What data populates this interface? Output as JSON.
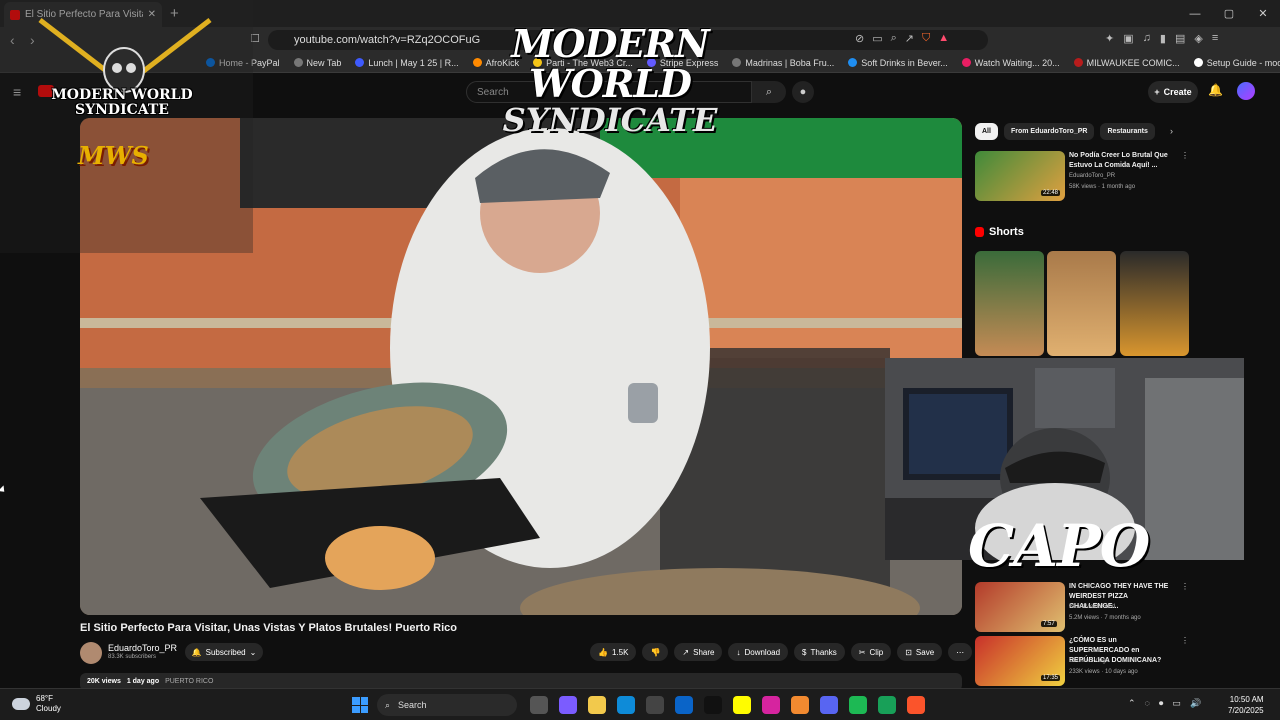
{
  "browser": {
    "tab_title": "El Sitio Perfecto Para Visitar, U",
    "new_tab": "+",
    "url": "youtube.com/watch?v=RZq2OCOFuG",
    "window_controls": [
      "—",
      "▢",
      "✕"
    ]
  },
  "bookmarks": [
    "Home - PayPal",
    "New Tab",
    "Lunch | May 1 25 | R...",
    "AfroKick",
    "Parti - The Web3 Cr...",
    "Stripe Express",
    "Madrinas | Boba Fru...",
    "Soft Drinks in Bever...",
    "Watch Waiting... 20...",
    "MILWAUKEE COMIC...",
    "Setup Guide - moon..."
  ],
  "youtube": {
    "search_placeholder": "Search",
    "create_label": "Create"
  },
  "video": {
    "title": "El Sitio Perfecto Para Visitar, Unas Vistas Y Platos Brutales! Puerto Rico",
    "channel": "EduardoToro_PR",
    "subscribers": "83.3K subscribers",
    "subscribed_label": "Subscribed",
    "likes": "1.5K",
    "share_label": "Share",
    "download_label": "Download",
    "thanks_label": "Thanks",
    "clip_label": "Clip",
    "save_label": "Save",
    "views": "20K views",
    "age": "1 day ago",
    "tag": "PUERTO RICO"
  },
  "sidebar": {
    "chips": [
      "All",
      "From EduardoToro_PR",
      "Restaurants"
    ],
    "shorts_heading": "Shorts",
    "recommendations": [
      {
        "title": "No Podía Creer Lo Brutal Que Estuvo La Comida Aquí! ...",
        "channel": "EduardoToro_PR",
        "meta": "58K views · 1 month ago",
        "duration": "22:48"
      },
      {
        "title": "IN CHICAGO THEY HAVE THE WEIRDEST PIZZA CHALLENGE...",
        "channel": "BeardMeetsFood",
        "meta": "5.2M views · 7 months ago",
        "duration": "7:57"
      },
      {
        "title": "¿CÓMO ES un SUPERMERCADO en REPÚBLICA DOMINICANA?",
        "channel": "Coreano Vlogs",
        "meta": "233K views · 10 days ago",
        "duration": "17:35"
      }
    ]
  },
  "overlay": {
    "center_line1": "MODERN WORLD",
    "center_line2": "SYNDICATE",
    "badge_text": "MODERN WORLD SYNDICATE",
    "badge_abbr": "MWS",
    "webcam_text": "CAPO"
  },
  "taskbar": {
    "temp": "68°F",
    "condition": "Cloudy",
    "search_label": "Search",
    "time": "10:50 AM",
    "date": "7/20/2025"
  }
}
